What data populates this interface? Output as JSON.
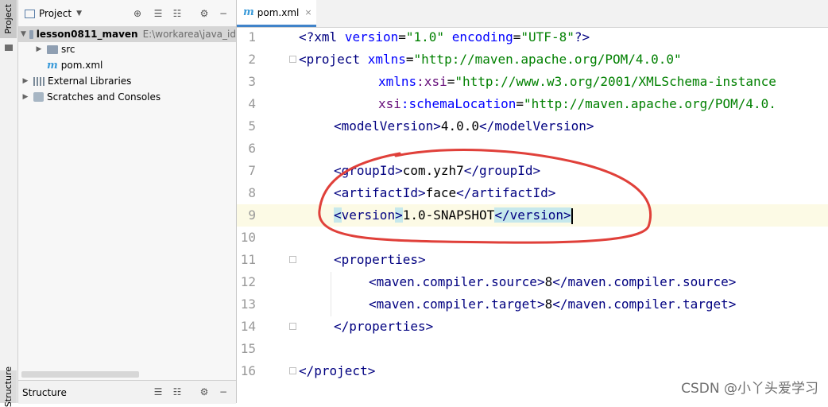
{
  "sidebar_strip": {
    "project_label": "Project",
    "structure_label": "Structure"
  },
  "project_panel": {
    "title": "Project",
    "tree": [
      {
        "label": "lesson0811_maven",
        "path": "E:\\workarea\\java_id",
        "expanded": true,
        "icon": "module-folder-icon"
      },
      {
        "label": "src",
        "expanded": false,
        "icon": "folder-icon"
      },
      {
        "label": "pom.xml",
        "icon": "maven-icon"
      },
      {
        "label": "External Libraries",
        "expanded": false,
        "icon": "library-icon"
      },
      {
        "label": "Scratches and Consoles",
        "expanded": false,
        "icon": "scratch-icon"
      }
    ],
    "toolbar_icons": [
      "crosshair-icon",
      "expand-all-icon",
      "collapse-all-icon",
      "gear-icon",
      "minimize-icon"
    ]
  },
  "structure_panel": {
    "title": "Structure"
  },
  "editor": {
    "tab": {
      "label": "pom.xml",
      "close_glyph": "×",
      "icon_glyph": "m"
    },
    "current_line": 9,
    "lines": [
      {
        "n": "1"
      },
      {
        "n": "2"
      },
      {
        "n": "3"
      },
      {
        "n": "4"
      },
      {
        "n": "5"
      },
      {
        "n": "6"
      },
      {
        "n": "7"
      },
      {
        "n": "8"
      },
      {
        "n": "9"
      },
      {
        "n": "10"
      },
      {
        "n": "11"
      },
      {
        "n": "12"
      },
      {
        "n": "13"
      },
      {
        "n": "14"
      },
      {
        "n": "15"
      },
      {
        "n": "16"
      }
    ],
    "code": {
      "l1": {
        "open": "<?",
        "tag": "xml",
        "a1": "version",
        "v1": "\"1.0\"",
        "a2": "encoding",
        "v2": "\"UTF-8\"",
        "close": "?>"
      },
      "l2": {
        "open": "<",
        "tag": "project",
        "attr": "xmlns",
        "val": "\"http://maven.apache.org/POM/4.0.0\""
      },
      "l3": {
        "ns": "xmlns",
        "attr": ":xsi",
        "val": "\"http://www.w3.org/2001/XMLSchema-instance"
      },
      "l4": {
        "ns": "xsi",
        "attr": ":schemaLocation",
        "val": "\"http://maven.apache.org/POM/4.0."
      },
      "l5": {
        "tag": "modelVersion",
        "value": "4.0.0"
      },
      "l7": {
        "tag": "groupId",
        "value": "com.yzh7"
      },
      "l8": {
        "tag": "artifactId",
        "value": "face"
      },
      "l9": {
        "tag": "version",
        "value": "1.0-SNAPSHOT"
      },
      "l11": {
        "tag": "properties"
      },
      "l12": {
        "tag": "maven.compiler.source",
        "value": "8"
      },
      "l13": {
        "tag": "maven.compiler.target",
        "value": "8"
      },
      "l14": {
        "tag": "properties"
      },
      "l16": {
        "tag": "project"
      }
    }
  },
  "watermark": "CSDN @小丫头爱学习",
  "colors": {
    "tag": "#000080",
    "attribute": "#0000ff",
    "string": "#008000",
    "namespace": "#660e7a",
    "annotation": "#e0403a",
    "tab_underline": "#4083c9"
  }
}
